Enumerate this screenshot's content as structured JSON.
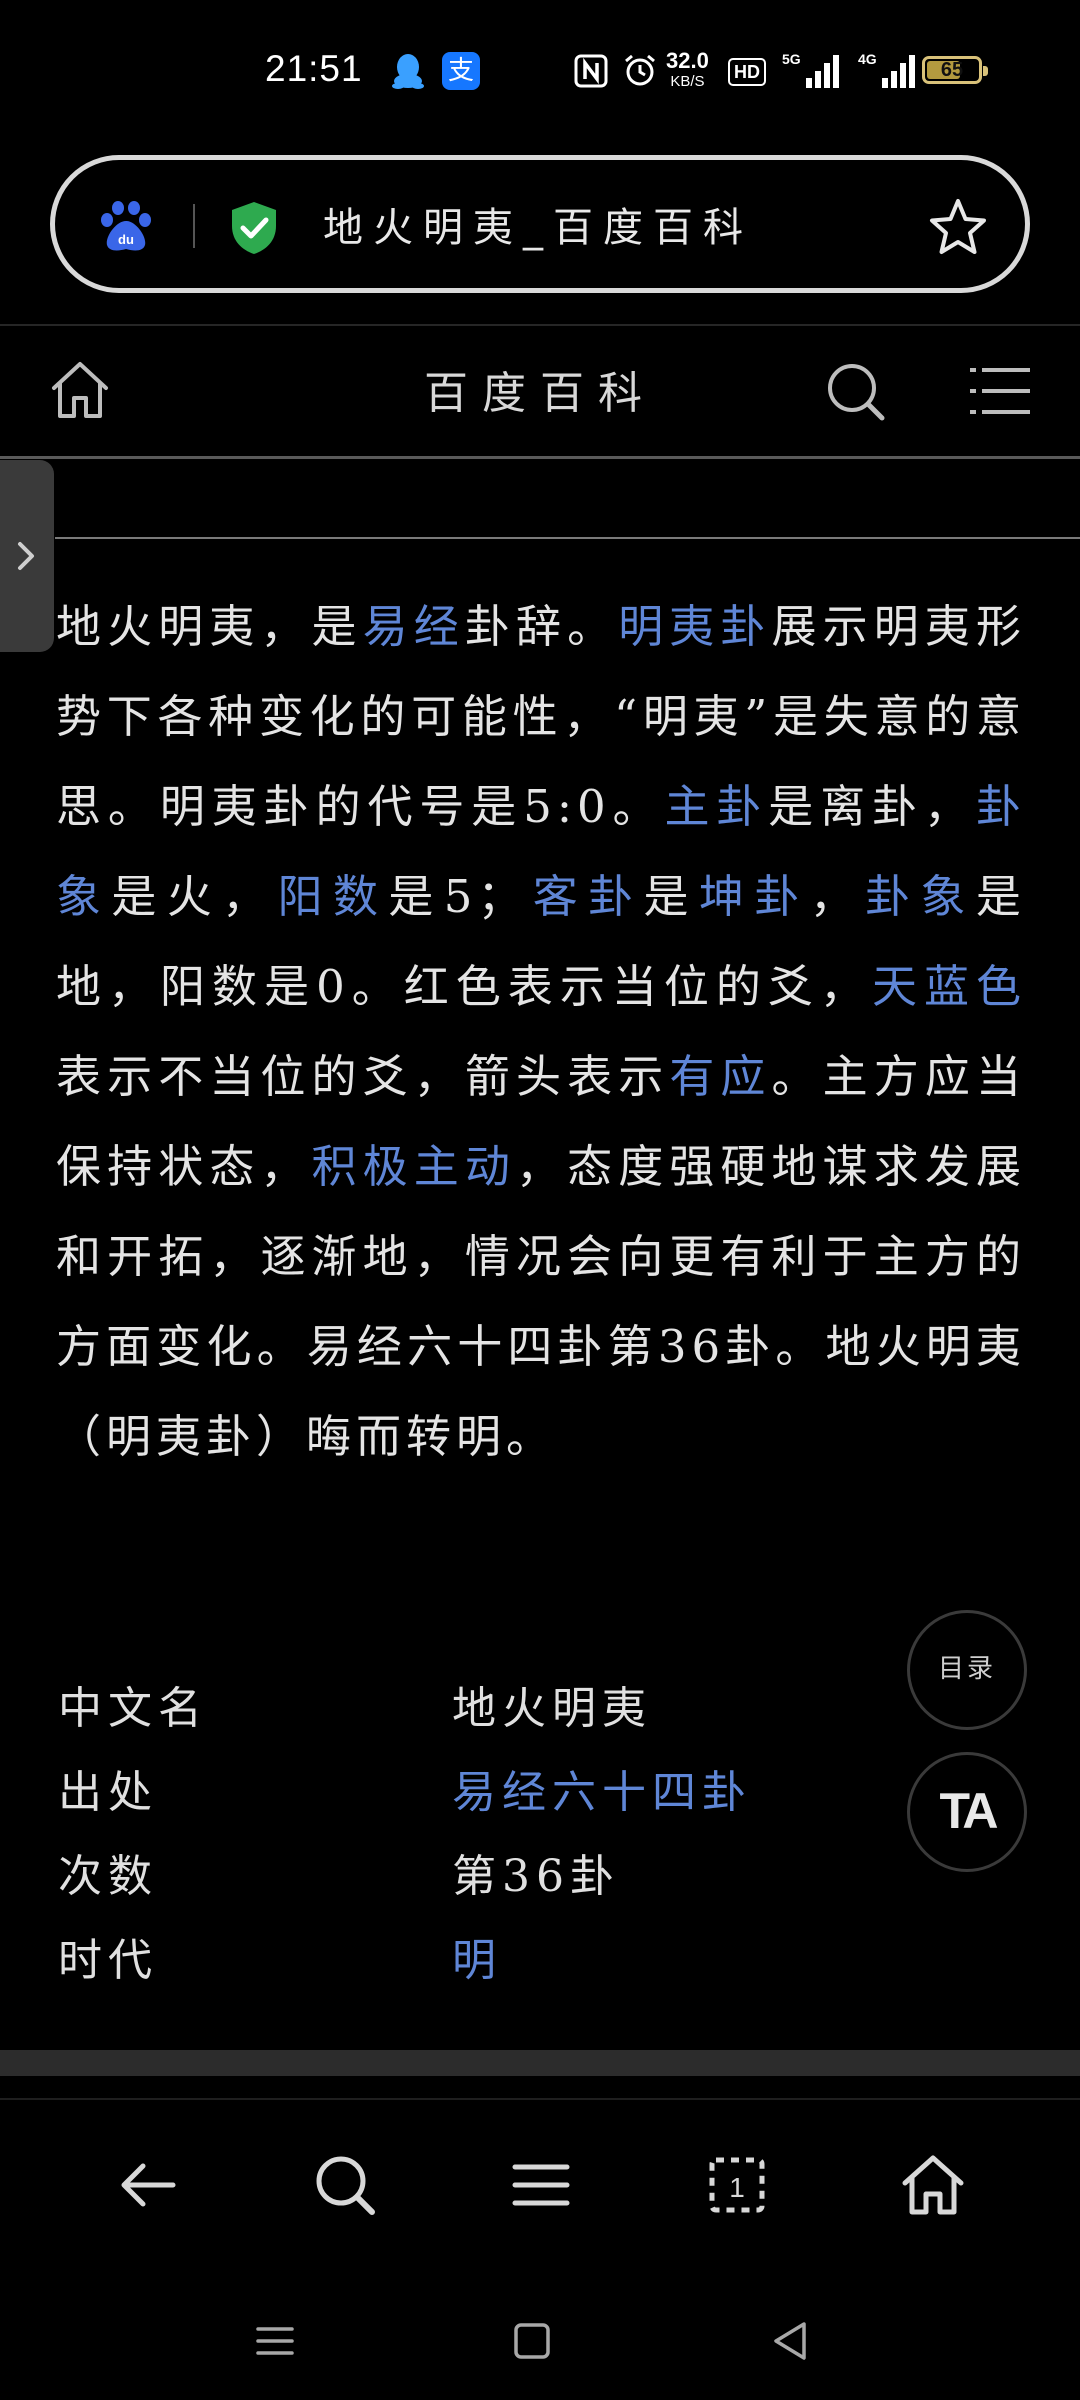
{
  "status_bar": {
    "time": "21:51",
    "net_speed_value": "32.0",
    "net_speed_unit": "KB/S",
    "hd_label": "HD",
    "battery_level": "65",
    "icons": [
      "qq-icon",
      "alipay-icon",
      "nfc-icon",
      "alarm-icon",
      "hd-voice-icon",
      "5g-signal-icon",
      "4g-signal-icon",
      "battery-icon"
    ]
  },
  "alipay_glyph": "支",
  "url_bar": {
    "title": "地火明夷_百度百科"
  },
  "site_nav": {
    "title": "百度百科"
  },
  "article": {
    "segments": [
      {
        "t": "地火明夷，是",
        "link": false
      },
      {
        "t": "易经",
        "link": true
      },
      {
        "t": "卦辞。",
        "link": false
      },
      {
        "t": "明夷卦",
        "link": true
      },
      {
        "t": "展示明夷形势下各种变化的可能性，“明夷”是失意的意思。明夷卦的代号是5:0。",
        "link": false
      },
      {
        "t": "主卦",
        "link": true
      },
      {
        "t": "是离卦，",
        "link": false
      },
      {
        "t": "卦象",
        "link": true
      },
      {
        "t": "是火，",
        "link": false
      },
      {
        "t": "阳数",
        "link": true
      },
      {
        "t": "是5；",
        "link": false
      },
      {
        "t": "客卦",
        "link": true
      },
      {
        "t": "是",
        "link": false
      },
      {
        "t": "坤卦",
        "link": true
      },
      {
        "t": "，",
        "link": false
      },
      {
        "t": "卦象",
        "link": true
      },
      {
        "t": "是地，阳数是0。红色表示当位的爻，",
        "link": false
      },
      {
        "t": "天蓝色",
        "link": true
      },
      {
        "t": "表示不当位的爻，箭头表示",
        "link": false
      },
      {
        "t": "有应",
        "link": true
      },
      {
        "t": "。主方应当保持状态，",
        "link": false
      },
      {
        "t": "积极主动",
        "link": true
      },
      {
        "t": "，态度强硬地谋求发展和开拓，逐渐地，情况会向更有利于主方的方面变化。易经六十四卦第36卦。地火明夷（明夷卦）晦而转明。",
        "link": false
      }
    ]
  },
  "infobox": {
    "rows": [
      {
        "key": "中文名",
        "value": "地火明夷",
        "link": false
      },
      {
        "key": "出处",
        "value": "易经六十四卦",
        "link": true
      },
      {
        "key": "次数",
        "value": "第36卦",
        "link": false
      },
      {
        "key": "时代",
        "value": "明",
        "link": true
      }
    ]
  },
  "floating": {
    "toc_label": "目录",
    "ta_label": "TA"
  },
  "colors": {
    "background": "#000000",
    "text": "#e4e4e4",
    "link": "#5f86d6",
    "shield_green": "#2eaa4f",
    "baidu_blue": "#3a66e8",
    "battery_gold": "#d9c27a"
  },
  "toolbar_icons": [
    "back-arrow-icon",
    "search-icon",
    "menu-icon",
    "tabs-icon",
    "home-icon"
  ],
  "system_nav_icons": [
    "recent-apps-icon",
    "home-square-icon",
    "back-triangle-icon"
  ]
}
